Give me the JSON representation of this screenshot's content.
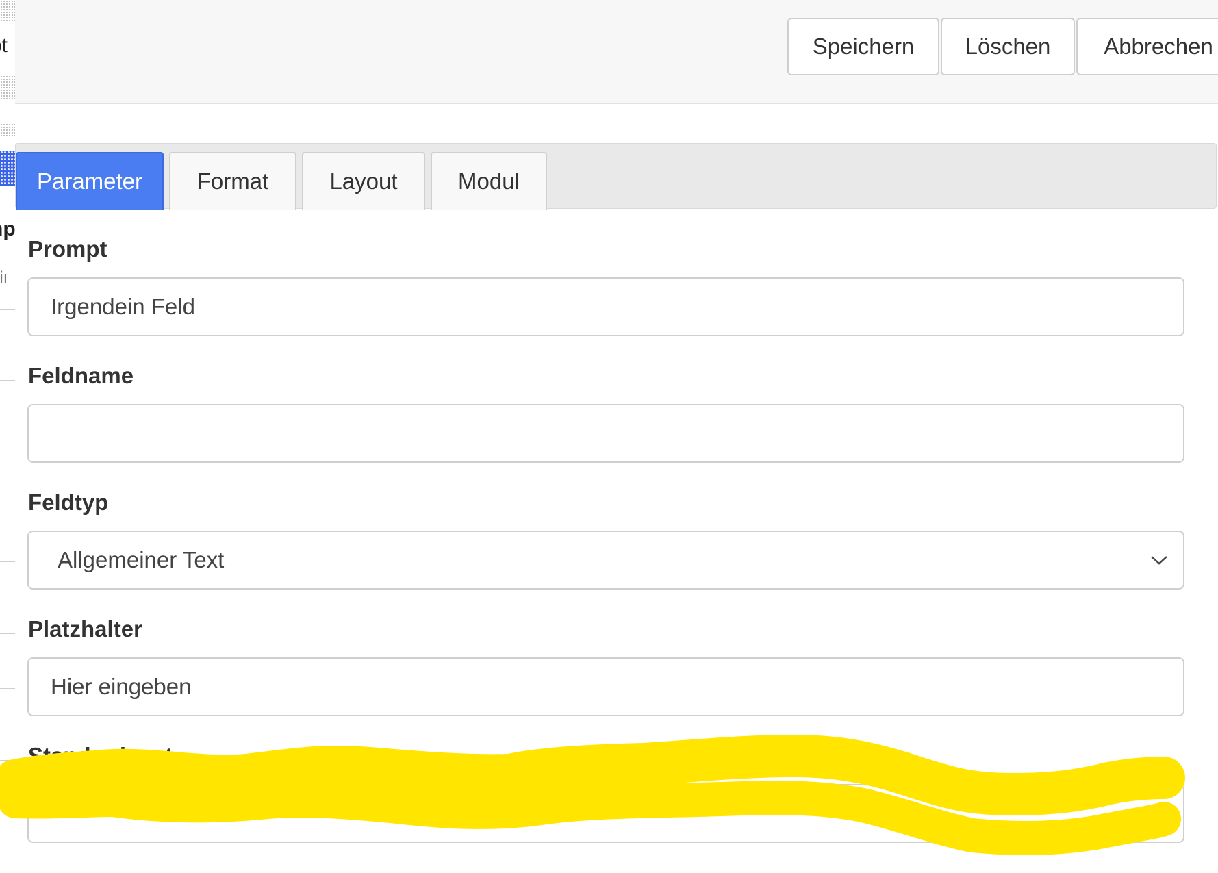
{
  "toolbar": {
    "save_label": "Speichern",
    "delete_label": "Löschen",
    "cancel_label": "Abbrechen"
  },
  "tabs": [
    {
      "label": "Parameter",
      "active": true
    },
    {
      "label": "Format",
      "active": false
    },
    {
      "label": "Layout",
      "active": false
    },
    {
      "label": "Modul",
      "active": false
    }
  ],
  "form": {
    "prompt": {
      "label": "Prompt",
      "value": "Irgendein Feld"
    },
    "feldname": {
      "label": "Feldname",
      "value": ""
    },
    "feldtyp": {
      "label": "Feldtyp",
      "selected": "Allgemeiner Text"
    },
    "platzhalter": {
      "label": "Platzhalter",
      "value": "Hier eingeben"
    },
    "standardwert": {
      "label": "Standardwert",
      "value": ""
    }
  },
  "left_fragments": {
    "top": "ɓt",
    "mid": "np",
    "lower": "eiı"
  },
  "colors": {
    "active_tab": "#4a7cf2",
    "highlight": "#ffe500",
    "toolbar_bg": "#f7f7f7"
  },
  "icons": {
    "select_arrow": "chevron-down-icon"
  }
}
